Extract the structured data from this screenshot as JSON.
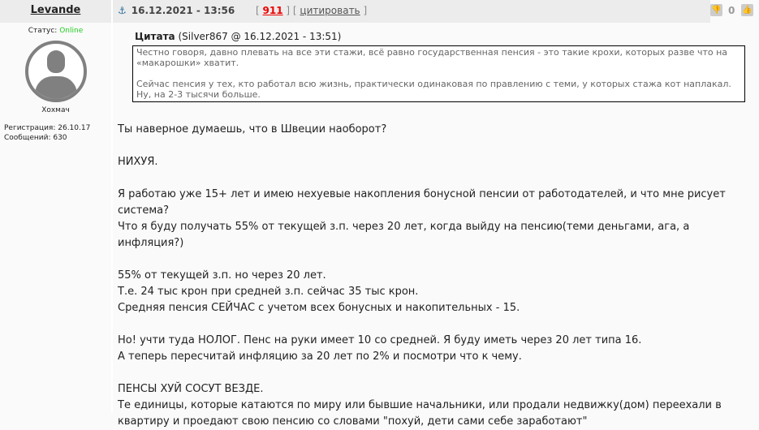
{
  "post": {
    "username": "Levande",
    "date": "16.12.2021 - 13:56",
    "number": "911",
    "quote_label": "цитировать",
    "rating": "0"
  },
  "user": {
    "status_label": "Статус:",
    "status": "Online",
    "rank": "Хохмач",
    "reg": "Регистрация: 26.10.17",
    "posts": "Сообщений: 630"
  },
  "quote": {
    "title": "Цитата",
    "source": "(Silver867 @ 16.12.2021 - 13:51)",
    "lines": [
      "Честно говоря, давно плевать на все эти стажи, всё равно государственная пенсия - это такие крохи, которых разве что на «макарошки» хватит.",
      "",
      "Сейчас пенсия у тех, кто работал всю жизнь, практически одинаковая по правлению с теми, у которых стажа кот наплакал. Ну, на 2-3 тысячи больше."
    ]
  },
  "message": [
    "Ты наверное думаешь, что в Швеции наоборот?",
    "",
    "НИХУЯ.",
    "",
    "Я работаю уже 15+ лет и имею нехуевые накопления бонусной пенсии от работодателей, и что мне рисует система?",
    "Что я буду получать 55% от текущей з.п. через 20 лет, когда выйду на пенсию(теми деньгами, ага, а инфляция?)",
    "",
    "55% от текущей з.п. но через 20 лет.",
    "Т.е. 24 тыс крон при средней з.п. сейчас 35 тыс крон.",
    "Средняя пенсия СЕЙЧАС с учетом всех бонусных и накопительных - 15.",
    "",
    "Но! учти туда НОЛОГ. Пенс на руки имеет 10 со средней. Я буду иметь через 20 лет типа 16.",
    "А теперь пересчитай инфляцию за 20 лет по 2% и посмотри что к чему.",
    "",
    "ПЕНСЫ ХУЙ СОСУТ ВЕЗДЕ.",
    "Те единицы, которые катаются по миру или бывшие начальники, или продали недвижку(дом) переехали в квартиру и проедают свою пенсию со словами \"похуй, дети сами себе заработают\""
  ]
}
